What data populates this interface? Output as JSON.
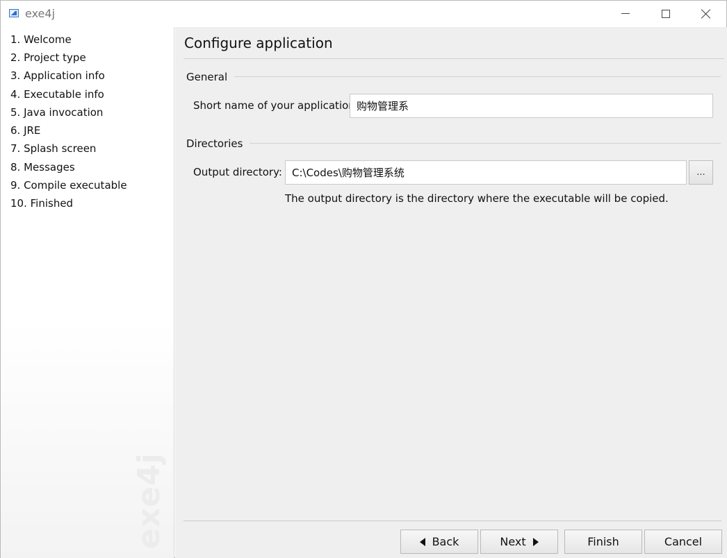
{
  "window": {
    "title": "exe4j",
    "controls": {
      "minimize": "minimize-icon",
      "maximize": "maximize-icon",
      "close": "close-icon"
    }
  },
  "sidebar": {
    "steps": [
      "1. Welcome",
      "2. Project type",
      "3. Application info",
      "4. Executable info",
      "5. Java invocation",
      "6. JRE",
      "7. Splash screen",
      "8. Messages",
      "9. Compile executable",
      "10. Finished"
    ],
    "watermark": "exe4j"
  },
  "main": {
    "title": "Configure application",
    "general": {
      "label": "General",
      "short_name_label": "Short name of your application:",
      "short_name_value": "购物管理系"
    },
    "directories": {
      "label": "Directories",
      "output_label": "Output directory:",
      "output_value": "C:\\Codes\\购物管理系统",
      "browse_label": "...",
      "help": "The output directory is the directory where the executable will be copied."
    }
  },
  "buttons": {
    "back": "Back",
    "next": "Next",
    "finish": "Finish",
    "cancel": "Cancel"
  }
}
